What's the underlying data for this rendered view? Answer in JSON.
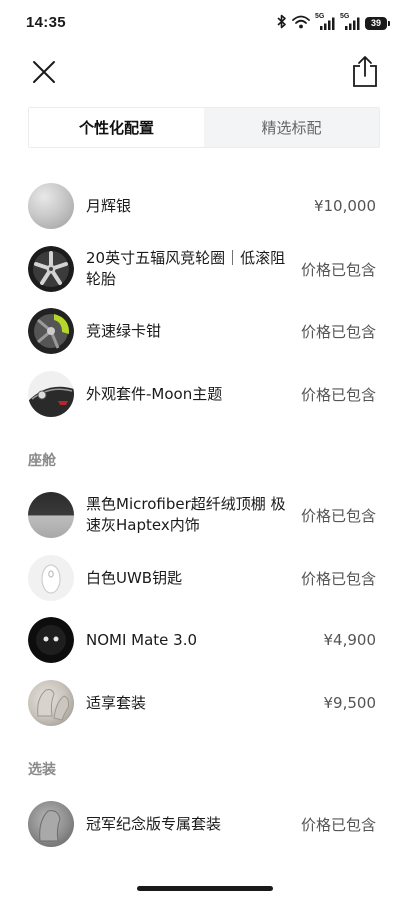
{
  "status_bar": {
    "time": "14:35",
    "network_1": "5G",
    "network_2": "5G",
    "battery": "39",
    "icons": [
      "bluetooth-icon",
      "wifi-icon",
      "signal-icon",
      "signal-icon",
      "battery-icon"
    ]
  },
  "topbar": {
    "close_icon": "close-icon",
    "share_icon": "share-icon"
  },
  "tabs": [
    {
      "label": "个性化配置",
      "active": true
    },
    {
      "label": "精选标配",
      "active": false
    }
  ],
  "exterior_items": [
    {
      "name": "月辉银",
      "price": "¥10,000"
    },
    {
      "name": "20英寸五辐风竞轮圈｜低滚阻轮胎",
      "price": "价格已包含"
    },
    {
      "name": "竞速绿卡钳",
      "price": "价格已包含"
    },
    {
      "name": "外观套件-Moon主题",
      "price": "价格已包含"
    }
  ],
  "cabin": {
    "title": "座舱",
    "items": [
      {
        "name": "黑色Microfiber超纤绒顶棚 极速灰Haptex内饰",
        "price": "价格已包含"
      },
      {
        "name": "白色UWB钥匙",
        "price": "价格已包含"
      },
      {
        "name": "NOMI Mate 3.0",
        "price": "¥4,900"
      },
      {
        "name": "适享套装",
        "price": "¥9,500"
      }
    ]
  },
  "options": {
    "title": "选装",
    "items": [
      {
        "name": "冠军纪念版专属套装",
        "price": "价格已包含"
      }
    ]
  }
}
